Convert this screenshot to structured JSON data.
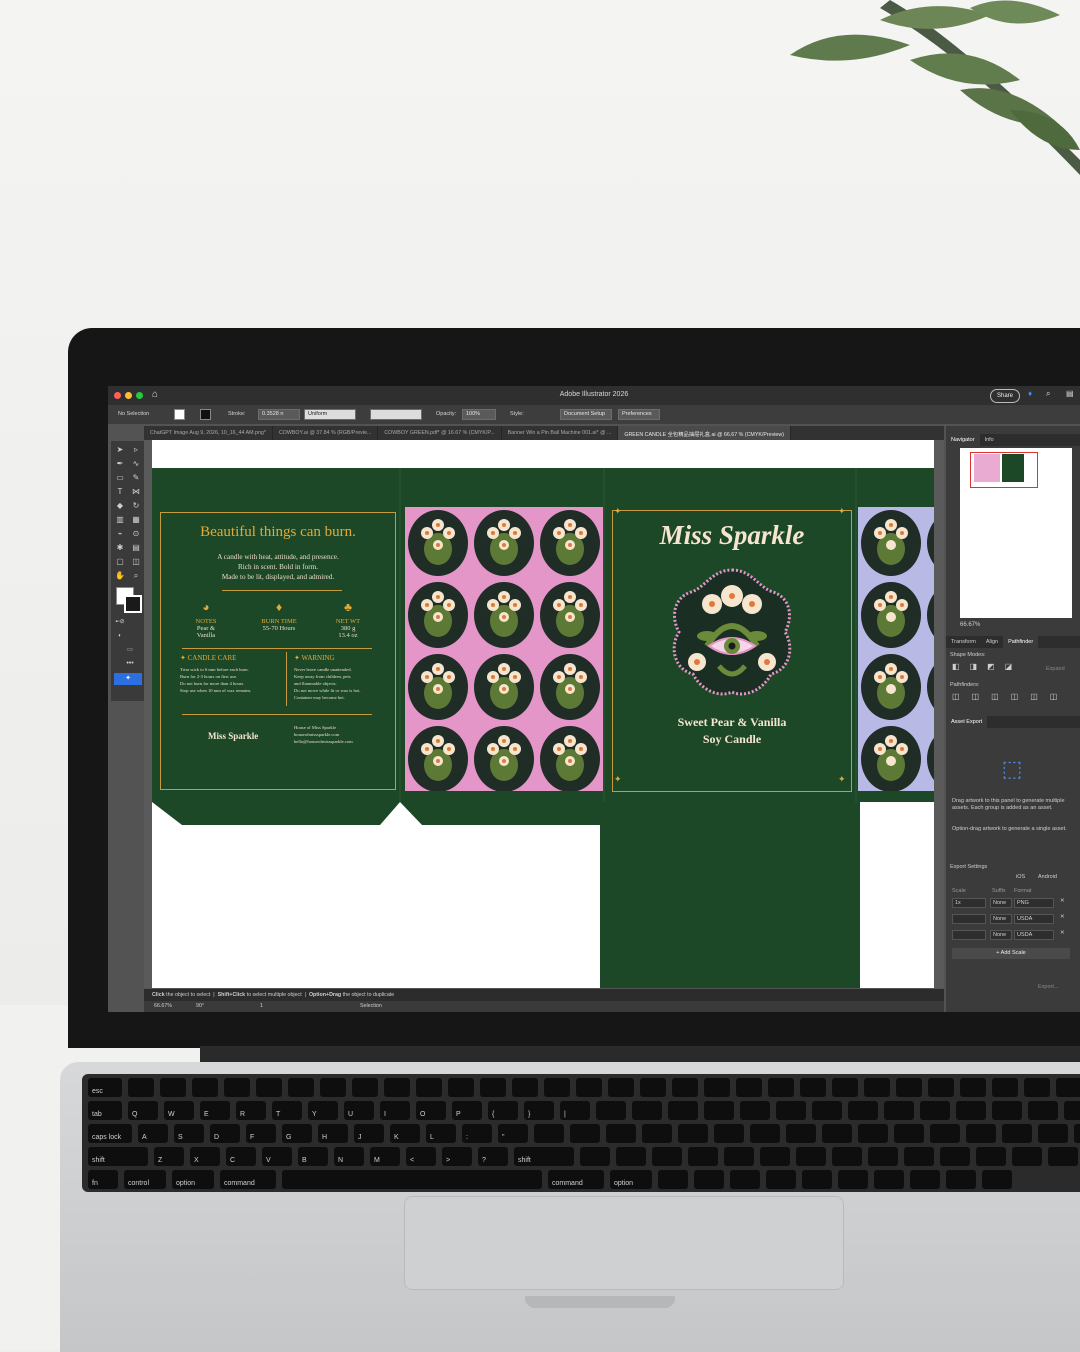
{
  "app": {
    "title": "Adobe Illustrator 2026",
    "share_label": "Share"
  },
  "control_bar": {
    "selection": "No Selection",
    "stroke_label": "Stroke:",
    "stroke_value": "0.3528 n",
    "uniform_label": "Uniform",
    "opacity_label": "Opacity:",
    "opacity_value": "100%",
    "style_label": "Style:",
    "document_setup": "Document Setup",
    "preferences": "Preferences"
  },
  "doc_tabs": [
    {
      "label": "ChatGPT Image Aug 9, 2026, 10_16_44 AM.png*",
      "active": false
    },
    {
      "label": "COWBOY.ai @ 37.84 % (RGB/Previe...",
      "active": false
    },
    {
      "label": "COWBOY GREEN.pdf* @ 16.67 % (CMYK/P...",
      "active": false
    },
    {
      "label": "Banner Win a Pin Ball Machine 001.ai* @ ...",
      "active": false
    },
    {
      "label": "GREEN CANDLE 全包精品抽屉礼盒.ai @ 66.67 % (CMYK/Preview)",
      "active": true
    }
  ],
  "navigator": {
    "tab_navigator": "Navigator",
    "tab_info": "Info",
    "zoom": "66.67%"
  },
  "pathfinder": {
    "tab_transform": "Transform",
    "tab_align": "Align",
    "tab_pathfinder": "Pathfinder",
    "shape_modes": "Shape Modes:",
    "expand": "Expand",
    "pathfinders": "Pathfinders:"
  },
  "asset_export": {
    "title": "Asset Export",
    "hint1": "Drag artwork to this panel to generate multiple assets. Each group is added as an asset.",
    "hint2": "Option-drag artwork to generate a single asset.",
    "settings_label": "Export Settings",
    "ios": "iOS",
    "android": "Android",
    "col_scale": "Scale",
    "col_suffix": "Suffix",
    "col_format": "Format",
    "rows": [
      {
        "scale": "1x",
        "suffix": "None",
        "format": "PNG"
      },
      {
        "scale": "",
        "suffix": "None",
        "format": "USDA"
      },
      {
        "scale": "",
        "suffix": "None",
        "format": "USDA"
      }
    ],
    "add_scale": "+ Add Scale",
    "export_btn": "Export..."
  },
  "status": {
    "hint_click": "Click",
    "hint_click_text": "the object to select",
    "hint_shift": "Shift+Click",
    "hint_shift_text": "to select multiple object",
    "hint_option": "Option+Drag",
    "hint_option_text": "the object to duplicate",
    "zoom": "66.67%",
    "rotation": "90°",
    "artboard": "1",
    "tool": "Selection"
  },
  "artwork": {
    "headline": "Beautiful things can burn.",
    "intro": [
      "A candle with heat, attitude, and presence.",
      "Rich in scent. Bold in form.",
      "Made to be lit, displayed, and admired."
    ],
    "notes_label": "NOTES",
    "notes_value": [
      "Pear &",
      "Vanilla"
    ],
    "burn_label": "BURN TIME",
    "burn_value": "55-70 Hours",
    "netwt_label": "NET WT",
    "netwt_value": [
      "380 g",
      "13.4 oz"
    ],
    "care_label": "CANDLE CARE",
    "care_text": [
      "Trim wick to 6 mm before each burn.",
      "Burn for 2-3 hours on first use.",
      "Do not burn for more than 4 hours.",
      "Stop use when 10 mm of wax remains."
    ],
    "warning_label": "WARNING",
    "warning_text": [
      "Never leave candle unattended.",
      "Keep away from children, pets",
      "and flammable objects.",
      "Do not move while lit or wax is hot.",
      "Container may become hot."
    ],
    "brand_small": "Miss Sparkle",
    "house": [
      "House of Miss Sparkle",
      "houseofmisssparkle.com",
      "hello@houseofmisssparkle.com"
    ],
    "brand": "Miss Sparkle",
    "product_line1": "Sweet Pear & Vanilla",
    "product_line2": "Soy Candle"
  },
  "colors": {
    "box_green": "#1d4828",
    "gold": "#e1aa3a",
    "pink": "#e596c8",
    "lavender": "#b9b9e6",
    "cream": "#f6e6cf"
  }
}
